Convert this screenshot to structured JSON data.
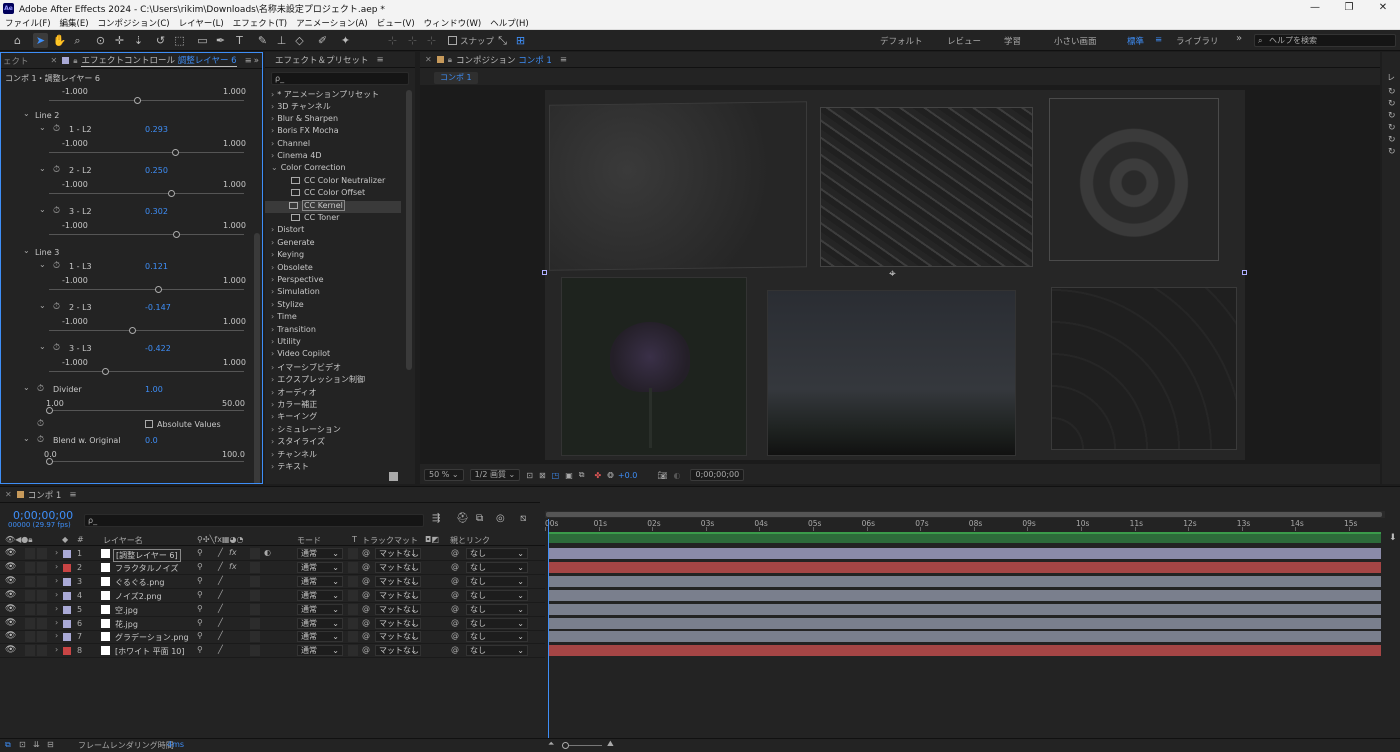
{
  "app": {
    "title": "Adobe After Effects 2024 - C:\\Users\\rikim\\Downloads\\名称未設定プロジェクト.aep *",
    "icon_text": "Ae",
    "accent": "#3e8ef7"
  },
  "menu": [
    "ファイル(F)",
    "編集(E)",
    "コンポジション(C)",
    "レイヤー(L)",
    "エフェクト(T)",
    "アニメーション(A)",
    "ビュー(V)",
    "ウィンドウ(W)",
    "ヘルプ(H)"
  ],
  "toolbar": {
    "snap_label": "スナップ",
    "workspaces": [
      "デフォルト",
      "レビュー",
      "学習",
      "小さい画面",
      "標準",
      "ライブラリ"
    ],
    "active_workspace": "標準",
    "help_placeholder": "ヘルプを検索"
  },
  "effect_controls": {
    "tab_prefix": "エフェクトコントロール",
    "tab_layer": "調整レイヤー 6",
    "left_stub": "ェクト",
    "header": "コンポ 1・調整レイヤー 6",
    "top_min": "-1.000",
    "top_max": "1.000",
    "groups": [
      {
        "name": "Line 2",
        "params": [
          {
            "label": "1 - L2",
            "value": "0.293",
            "min": "-1.000",
            "max": "1.000",
            "pos": 0.647
          },
          {
            "label": "2 - L2",
            "value": "0.250",
            "min": "-1.000",
            "max": "1.000",
            "pos": 0.625
          },
          {
            "label": "3 - L2",
            "value": "0.302",
            "min": "-1.000",
            "max": "1.000",
            "pos": 0.651
          }
        ]
      },
      {
        "name": "Line 3",
        "params": [
          {
            "label": "1 - L3",
            "value": "0.121",
            "min": "-1.000",
            "max": "1.000",
            "pos": 0.56
          },
          {
            "label": "2 - L3",
            "value": "-0.147",
            "min": "-1.000",
            "max": "1.000",
            "pos": 0.427
          },
          {
            "label": "3 - L3",
            "value": "-0.422",
            "min": "-1.000",
            "max": "1.000",
            "pos": 0.289
          }
        ]
      }
    ],
    "divider": {
      "label": "Divider",
      "value": "1.00",
      "min": "1.00",
      "max": "50.00",
      "pos": 0.0
    },
    "absolute_values": "Absolute Values",
    "blend": {
      "label": "Blend w. Original",
      "value": "0.0",
      "min": "0.0",
      "max": "100.0",
      "pos": 0.0
    }
  },
  "effects_presets": {
    "tab": "エフェクト＆プリセット",
    "search_placeholder": "ρ_",
    "items": [
      {
        "label": "* アニメーションプリセット",
        "type": "folder"
      },
      {
        "label": "3D チャンネル",
        "type": "folder"
      },
      {
        "label": "Blur & Sharpen",
        "type": "folder"
      },
      {
        "label": "Boris FX Mocha",
        "type": "folder"
      },
      {
        "label": "Channel",
        "type": "folder"
      },
      {
        "label": "Cinema 4D",
        "type": "folder"
      },
      {
        "label": "Color Correction",
        "type": "open"
      },
      {
        "label": "CC Color Neutralizer",
        "type": "effect"
      },
      {
        "label": "CC Color Offset",
        "type": "effect"
      },
      {
        "label": "CC Kernel",
        "type": "effect",
        "selected": true
      },
      {
        "label": "CC Toner",
        "type": "effect"
      },
      {
        "label": "Distort",
        "type": "folder"
      },
      {
        "label": "Generate",
        "type": "folder"
      },
      {
        "label": "Keying",
        "type": "folder"
      },
      {
        "label": "Obsolete",
        "type": "folder"
      },
      {
        "label": "Perspective",
        "type": "folder"
      },
      {
        "label": "Simulation",
        "type": "folder"
      },
      {
        "label": "Stylize",
        "type": "folder"
      },
      {
        "label": "Time",
        "type": "folder"
      },
      {
        "label": "Transition",
        "type": "folder"
      },
      {
        "label": "Utility",
        "type": "folder"
      },
      {
        "label": "Video Copilot",
        "type": "folder"
      },
      {
        "label": "イマーシブビデオ",
        "type": "folder"
      },
      {
        "label": "エクスプレッション制御",
        "type": "folder"
      },
      {
        "label": "オーディオ",
        "type": "folder"
      },
      {
        "label": "カラー補正",
        "type": "folder"
      },
      {
        "label": "キーイング",
        "type": "folder"
      },
      {
        "label": "シミュレーション",
        "type": "folder"
      },
      {
        "label": "スタイライズ",
        "type": "folder"
      },
      {
        "label": "チャンネル",
        "type": "folder"
      },
      {
        "label": "テキスト",
        "type": "folder"
      }
    ]
  },
  "composition": {
    "tab_prefix": "コンポジション",
    "tab_name": "コンポ 1",
    "subtab": "コンポ 1",
    "zoom": "50 %",
    "resolution": "1/2 画質",
    "exposure": "+0.0",
    "timecode": "0;00;00;00"
  },
  "timeline": {
    "tab": "コンポ 1",
    "timecode": "0;00;00;00",
    "frame_info": "00000 (29.97 fps)",
    "search_placeholder": "ρ_",
    "col_name": "レイヤー名",
    "col_mode": "モード",
    "col_t": "T",
    "col_trackmatte": "トラックマット",
    "col_parent": "親とリンク",
    "col_num": "#",
    "ticks": [
      "00s",
      "01s",
      "02s",
      "03s",
      "04s",
      "05s",
      "06s",
      "07s",
      "08s",
      "09s",
      "10s",
      "11s",
      "12s",
      "13s",
      "14s",
      "15s"
    ],
    "layers": [
      {
        "num": "1",
        "name": "[調整レイヤー 6]",
        "label_color": "#a9a9d6",
        "bar_color": "#8b8ba9",
        "mode": "通常",
        "trackmatte": "マットなし",
        "parent": "なし",
        "fx": true
      },
      {
        "num": "2",
        "name": "フラクタルノイズ",
        "label_color": "#c84444",
        "bar_color": "#a54545",
        "mode": "通常",
        "trackmatte": "マットなし",
        "parent": "なし",
        "fx": true
      },
      {
        "num": "3",
        "name": "ぐるぐる.png",
        "label_color": "#a9a9d6",
        "bar_color": "#7a7f8d",
        "mode": "通常",
        "trackmatte": "マットなし",
        "parent": "なし",
        "fx": false
      },
      {
        "num": "4",
        "name": "ノイズ2.png",
        "label_color": "#a9a9d6",
        "bar_color": "#7a7f8d",
        "mode": "通常",
        "trackmatte": "マットなし",
        "parent": "なし",
        "fx": false
      },
      {
        "num": "5",
        "name": "空.jpg",
        "label_color": "#a9a9d6",
        "bar_color": "#7a7f8d",
        "mode": "通常",
        "trackmatte": "マットなし",
        "parent": "なし",
        "fx": false
      },
      {
        "num": "6",
        "name": "花.jpg",
        "label_color": "#a9a9d6",
        "bar_color": "#7a7f8d",
        "mode": "通常",
        "trackmatte": "マットなし",
        "parent": "なし",
        "fx": false
      },
      {
        "num": "7",
        "name": "グラデーション.png",
        "label_color": "#a9a9d6",
        "bar_color": "#7a7f8d",
        "mode": "通常",
        "trackmatte": "マットなし",
        "parent": "なし",
        "fx": false
      },
      {
        "num": "8",
        "name": "[ホワイト 平面 10]",
        "label_color": "#c84444",
        "bar_color": "#a54545",
        "mode": "通常",
        "trackmatte": "マットなし",
        "parent": "なし",
        "fx": false
      }
    ]
  },
  "status": {
    "render_label": "フレームレンダリング時間",
    "render_time": "4ms"
  }
}
